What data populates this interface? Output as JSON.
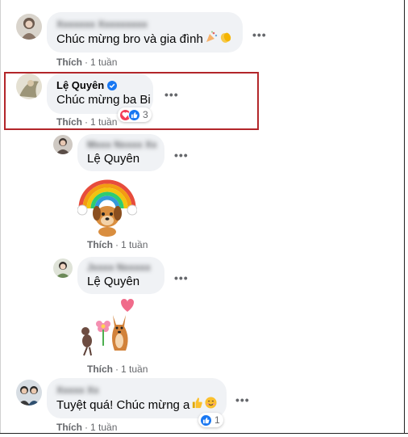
{
  "colors": {
    "bubble": "#f0f2f5",
    "meta_text": "#65676b",
    "verified": "#1877f2",
    "like_blue": "#1877f2",
    "love_red": "#f33e58",
    "highlight_border": "#b3262a"
  },
  "comments": [
    {
      "author": "",
      "author_blurred": true,
      "text": "Chúc mừng bro và gia đình",
      "emojis": [
        "party-popper-icon",
        "clapping-hands-icon"
      ],
      "like_label": "Thích",
      "time": "1 tuần"
    },
    {
      "author": "Lệ Quyên",
      "author_blurred": false,
      "verified": true,
      "text": "Chúc mừng ba Bi",
      "like_label": "Thích",
      "time": "1 tuần",
      "reactions": [
        "love-reaction-icon",
        "like-reaction-icon"
      ],
      "reaction_count": "3",
      "highlighted": true
    },
    {
      "author": "",
      "author_blurred": true,
      "mention": "Lệ Quyên",
      "sticker": "rainbow-dog-sticker",
      "like_label": "Thích",
      "time": "1 tuần",
      "reply": true
    },
    {
      "author": "",
      "author_blurred": true,
      "mention": "Lệ Quyên",
      "sticker": "dogs-flower-heart-sticker",
      "like_label": "Thích",
      "time": "1 tuần",
      "reply": true
    },
    {
      "author": "",
      "author_blurred": true,
      "text": "Tuyệt quá! Chúc mừng a",
      "emojis": [
        "thumbs-up-icon",
        "smiling-face-icon"
      ],
      "like_label": "Thích",
      "time": "1 tuần",
      "reactions": [
        "like-reaction-icon"
      ],
      "reaction_count": "1"
    }
  ],
  "separator": "·",
  "more_label": "•••"
}
